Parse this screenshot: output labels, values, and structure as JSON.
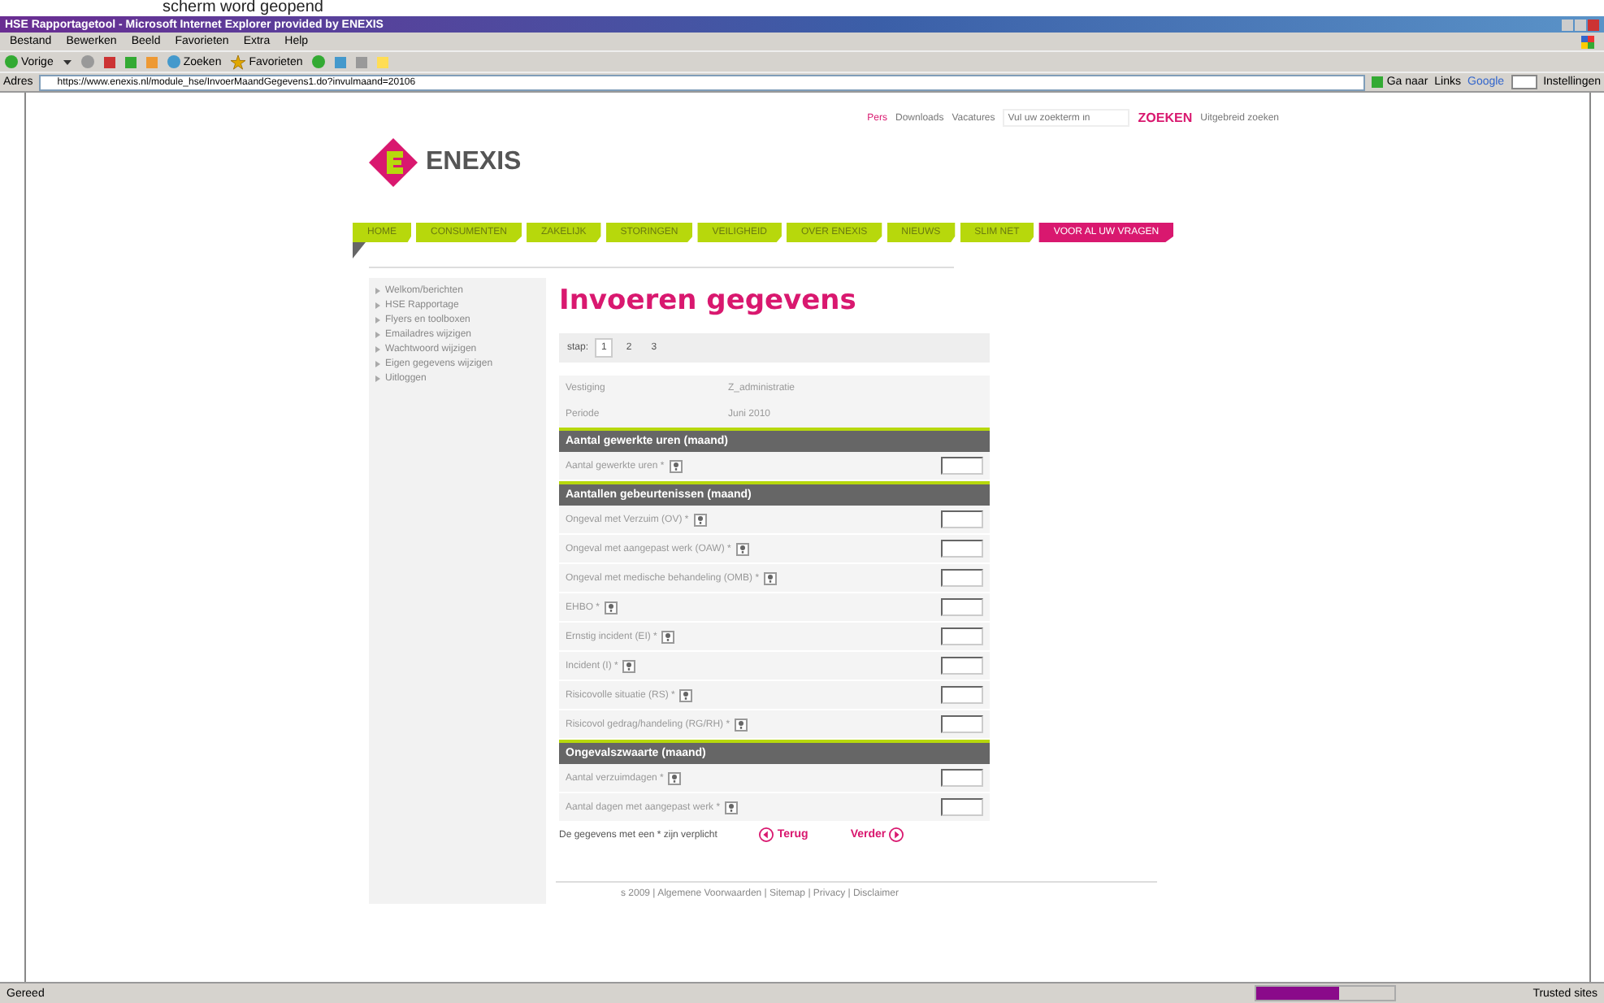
{
  "caption": "scherm word geopend",
  "window": {
    "title": "HSE Rapportagetool - Microsoft Internet Explorer provided by ENEXIS"
  },
  "menu": [
    "Bestand",
    "Bewerken",
    "Beeld",
    "Favorieten",
    "Extra",
    "Help"
  ],
  "toolbar": {
    "back": "Vorige",
    "search": "Zoeken",
    "favorites": "Favorieten"
  },
  "address": {
    "label": "Adres",
    "url": "https://www.enexis.nl/module_hse/InvoerMaandGegevens1.do?invulmaand=20106",
    "go": "Ga naar",
    "links": "Links",
    "google": "Google",
    "settings": "Instellingen"
  },
  "header": {
    "logo": "ENEXIS",
    "top_links": [
      "Pers",
      "Downloads",
      "Vacatures"
    ],
    "search_placeholder": "Vul uw zoekterm in",
    "search_button": "ZOEKEN",
    "advanced": "Uitgebreid zoeken"
  },
  "nav": [
    {
      "label": "HOME",
      "highlighted": false
    },
    {
      "label": "CONSUMENTEN",
      "highlighted": false
    },
    {
      "label": "ZAKELIJK",
      "highlighted": false
    },
    {
      "label": "STORINGEN",
      "highlighted": false
    },
    {
      "label": "VEILIGHEID",
      "highlighted": false
    },
    {
      "label": "OVER ENEXIS",
      "highlighted": false
    },
    {
      "label": "NIEUWS",
      "highlighted": false
    },
    {
      "label": "SLIM NET",
      "highlighted": false
    },
    {
      "label": "VOOR AL UW VRAGEN",
      "highlighted": true
    }
  ],
  "sidebar": [
    "Welkom/berichten",
    "HSE Rapportage",
    "Flyers en toolboxen",
    "Emailadres wijzigen",
    "Wachtwoord wijzigen",
    "Eigen gegevens wijzigen",
    "Uitloggen"
  ],
  "title": "Invoeren gegevens",
  "steps": {
    "label": "stap:",
    "items": [
      {
        "label": "1",
        "selected": true
      },
      {
        "label": "2",
        "selected": false
      },
      {
        "label": "3",
        "selected": false
      }
    ]
  },
  "info": [
    {
      "label": "Vestiging",
      "value": "Z_administratie"
    },
    {
      "label": "Periode",
      "value": "Juni 2010"
    }
  ],
  "sections": [
    {
      "title": "Aantal gewerkte uren (maand)",
      "fields": [
        "Aantal gewerkte uren *"
      ]
    },
    {
      "title": "Aantallen gebeurtenissen (maand)",
      "fields": [
        "Ongeval met Verzuim (OV) *",
        "Ongeval met aangepast werk (OAW) *",
        "Ongeval met medische behandeling (OMB) *",
        "EHBO *",
        "Ernstig incident (EI) *",
        "Incident (I) *",
        "Risicovolle situatie (RS) *",
        "Risicovol gedrag/handeling (RG/RH) *"
      ]
    },
    {
      "title": "Ongevalszwaarte (maand)",
      "fields": [
        "Aantal verzuimdagen *",
        "Aantal dagen met aangepast werk *"
      ]
    }
  ],
  "required_note": "De gegevens met een * zijn verplicht",
  "back": "Terug",
  "next": "Verder",
  "footer": "s 2009 | Algemene Voorwaarden | Sitemap | Privacy | Disclaimer",
  "status": {
    "text": "Gereed",
    "level": 0.6,
    "zone": "Trusted sites"
  }
}
